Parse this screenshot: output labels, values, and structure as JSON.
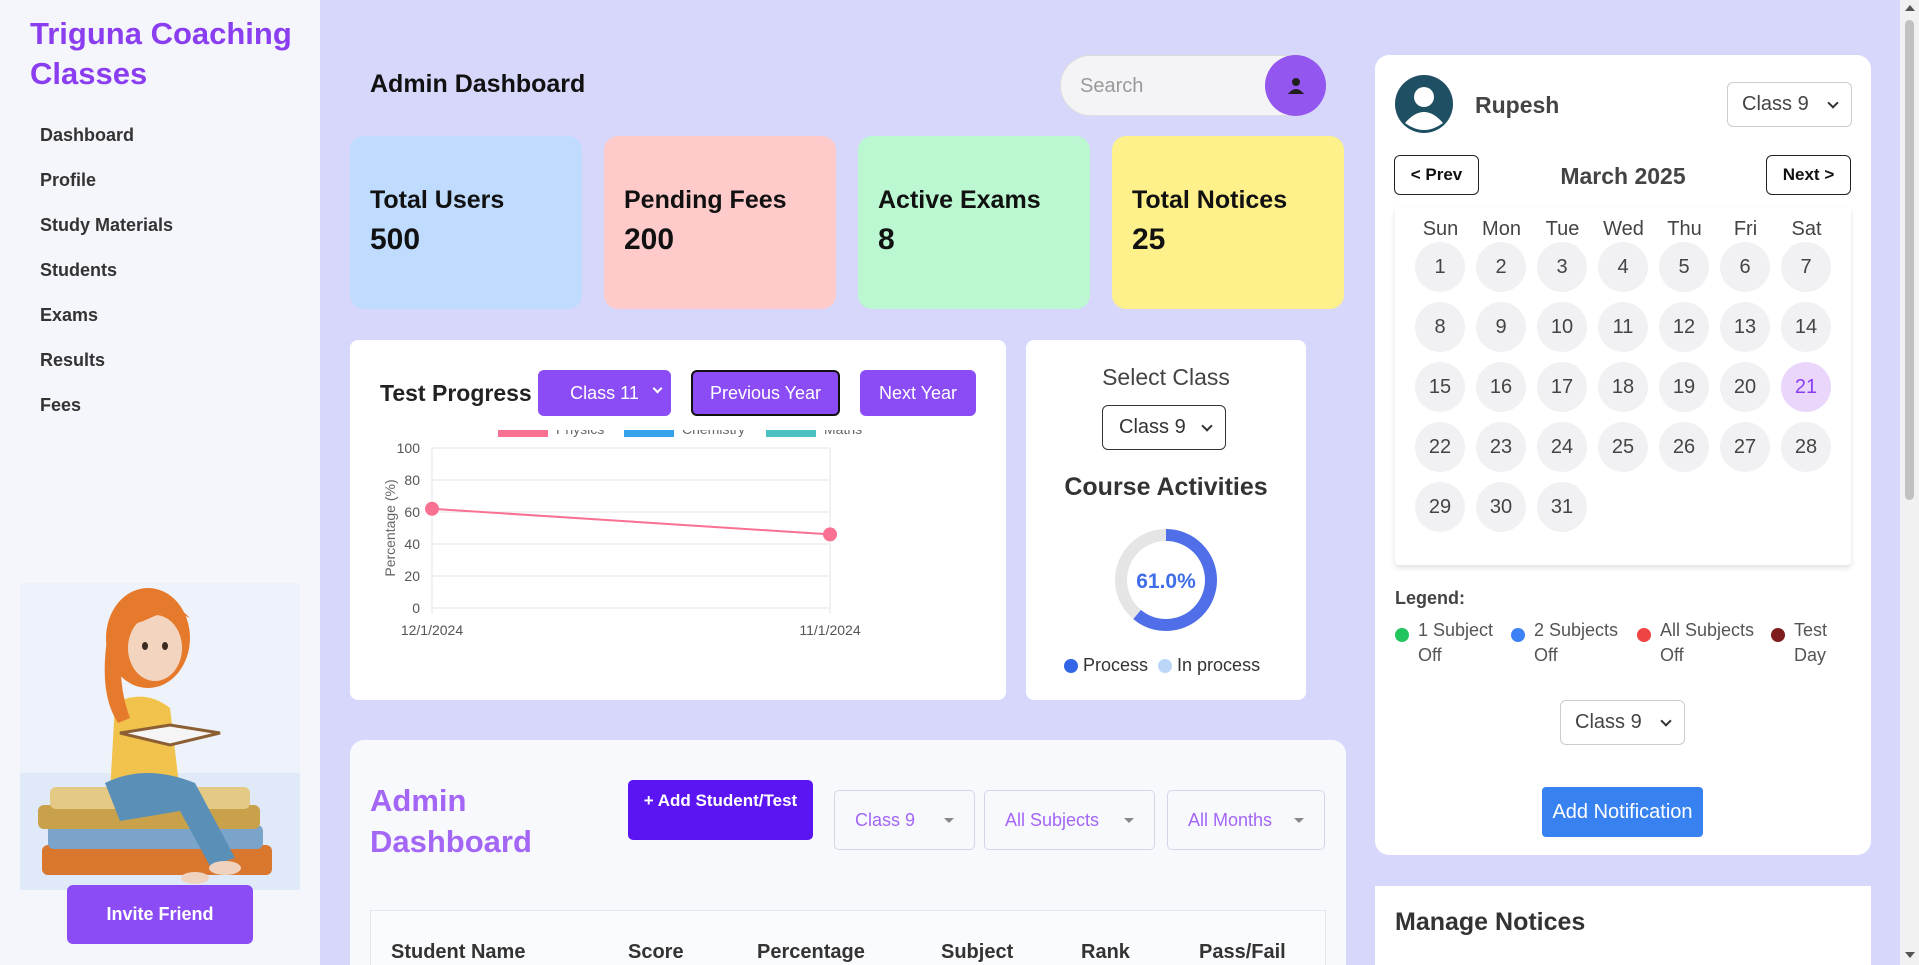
{
  "brand": "Triguna Coaching Classes",
  "nav": [
    "Dashboard",
    "Profile",
    "Study Materials",
    "Students",
    "Exams",
    "Results",
    "Fees"
  ],
  "invite_button": "Invite Friend",
  "header": {
    "title": "Admin Dashboard",
    "search_placeholder": "Search"
  },
  "stats": [
    {
      "label": "Total Users",
      "value": "500",
      "color": "#bfdbfe"
    },
    {
      "label": "Pending Fees",
      "value": "200",
      "color": "#fecaca"
    },
    {
      "label": "Active Exams",
      "value": "8",
      "color": "#bbf7d0"
    },
    {
      "label": "Total Notices",
      "value": "25",
      "color": "#fef08a"
    }
  ],
  "test_progress": {
    "title": "Test Progress",
    "class_select": "Class 11",
    "prev_year": "Previous Year",
    "next_year": "Next Year"
  },
  "chart_data": {
    "type": "line",
    "x": [
      "12/1/2024",
      "11/1/2024"
    ],
    "series": [
      {
        "name": "Physics",
        "color": "#f87193",
        "values": [
          62,
          46
        ]
      },
      {
        "name": "Chemistry",
        "color": "#36a2eb",
        "values": []
      },
      {
        "name": "Maths",
        "color": "#4bc0c0",
        "values": []
      }
    ],
    "ylabel": "Percentage (%)",
    "ylim": [
      0,
      100
    ],
    "yticks": [
      0,
      20,
      40,
      60,
      80,
      100
    ],
    "grid": true,
    "legend": "top"
  },
  "select_class": {
    "label": "Select Class",
    "value": "Class 9",
    "activities_title": "Course Activities",
    "percent_label": "61.0%",
    "percent": 61.0,
    "legend": [
      {
        "label": "Process",
        "color": "#3366e6"
      },
      {
        "label": "In process",
        "color": "#bcd6f8"
      }
    ]
  },
  "admin": {
    "title": "Admin Dashboard",
    "add_button": "+ Add Student/Test",
    "filters": [
      "Class 9",
      "All Subjects",
      "All Months"
    ],
    "columns": [
      "Student Name",
      "Score",
      "Percentage",
      "Subject",
      "Rank",
      "Pass/Fail"
    ]
  },
  "right_panel": {
    "user_name": "Rupesh",
    "class_select": "Class 9",
    "prev": "< Prev",
    "next": "Next >",
    "month": "March 2025",
    "weekdays": [
      "Sun",
      "Mon",
      "Tue",
      "Wed",
      "Thu",
      "Fri",
      "Sat"
    ],
    "days_in_month": 31,
    "selected_day": 21,
    "legend_title": "Legend:",
    "legend": [
      {
        "label": "1 Subject Off",
        "color": "#22c55e"
      },
      {
        "label": "2 Subjects Off",
        "color": "#3b82f6"
      },
      {
        "label": "All Subjects Off",
        "color": "#ef4444"
      },
      {
        "label": "Test Day",
        "color": "#7f1d1d"
      }
    ],
    "notif_class": "Class 9",
    "add_notification": "Add Notification",
    "notices_title": "Manage Notices"
  }
}
